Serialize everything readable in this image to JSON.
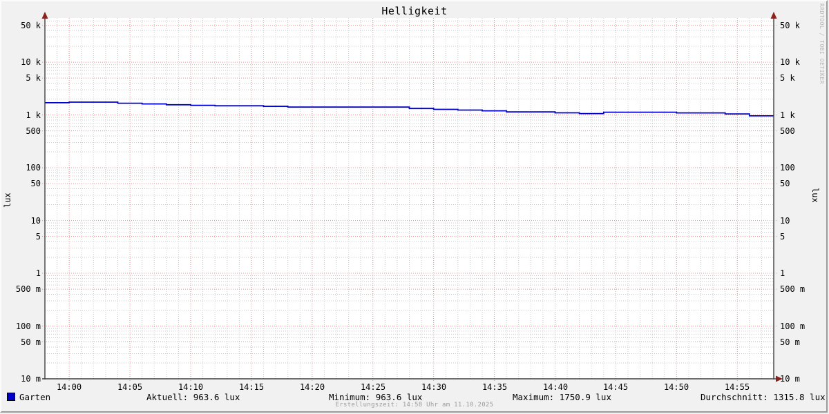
{
  "title": "Helligkeit",
  "watermark": "RRDTOOL / TOBI OETIKER",
  "axis_left_unit": "lux",
  "axis_right_unit": "lux",
  "legend": {
    "series_label": "Garten",
    "stats": [
      "Aktuell: 963.6 lux",
      "Minimum: 963.6 lux",
      "Maximum: 1750.9 lux",
      "Durchschnitt: 1315.8 lux"
    ],
    "created": "Erstellungszeit: 14:58 Uhr am 11.10.2025"
  },
  "chart_data": {
    "type": "line",
    "title": "Helligkeit",
    "xlabel": "",
    "ylabel": "lux",
    "y_scale": "log",
    "ylim": [
      0.01,
      69000
    ],
    "grid": true,
    "legend_position": "bottom",
    "y_tick_labels": [
      [
        "50 k",
        50000
      ],
      [
        "10 k",
        10000
      ],
      [
        "5 k",
        5000
      ],
      [
        "1 k",
        1000
      ],
      [
        "500",
        500
      ],
      [
        "100",
        100
      ],
      [
        "50",
        50
      ],
      [
        "10",
        10
      ],
      [
        "5",
        5
      ],
      [
        "1",
        1
      ],
      [
        "500 m",
        0.5
      ],
      [
        "100 m",
        0.1
      ],
      [
        "50 m",
        0.05
      ],
      [
        "10 m",
        0.01
      ]
    ],
    "x_range": [
      "13:58",
      "14:58"
    ],
    "x_tick_labels": [
      "14:00",
      "14:05",
      "14:10",
      "14:15",
      "14:20",
      "14:25",
      "14:30",
      "14:35",
      "14:40",
      "14:45",
      "14:50",
      "14:55"
    ],
    "series": [
      {
        "name": "Garten",
        "color": "#0000c8",
        "points": [
          [
            "13:58",
            1705
          ],
          [
            "14:00",
            1750.9
          ],
          [
            "14:04",
            1672
          ],
          [
            "14:06",
            1620
          ],
          [
            "14:08",
            1565
          ],
          [
            "14:10",
            1522
          ],
          [
            "14:12",
            1492
          ],
          [
            "14:16",
            1458
          ],
          [
            "14:18",
            1412
          ],
          [
            "14:28",
            1330
          ],
          [
            "14:30",
            1278
          ],
          [
            "14:32",
            1238
          ],
          [
            "14:34",
            1198
          ],
          [
            "14:36",
            1142
          ],
          [
            "14:40",
            1098
          ],
          [
            "14:42",
            1062
          ],
          [
            "14:44",
            1128
          ],
          [
            "14:50",
            1094
          ],
          [
            "14:54",
            1046
          ],
          [
            "14:56",
            963.6
          ],
          [
            "14:58",
            963.6
          ]
        ]
      }
    ],
    "stats": {
      "aktuell": 963.6,
      "minimum": 963.6,
      "maximum": 1750.9,
      "durchschnitt": 1315.8,
      "unit": "lux"
    }
  }
}
